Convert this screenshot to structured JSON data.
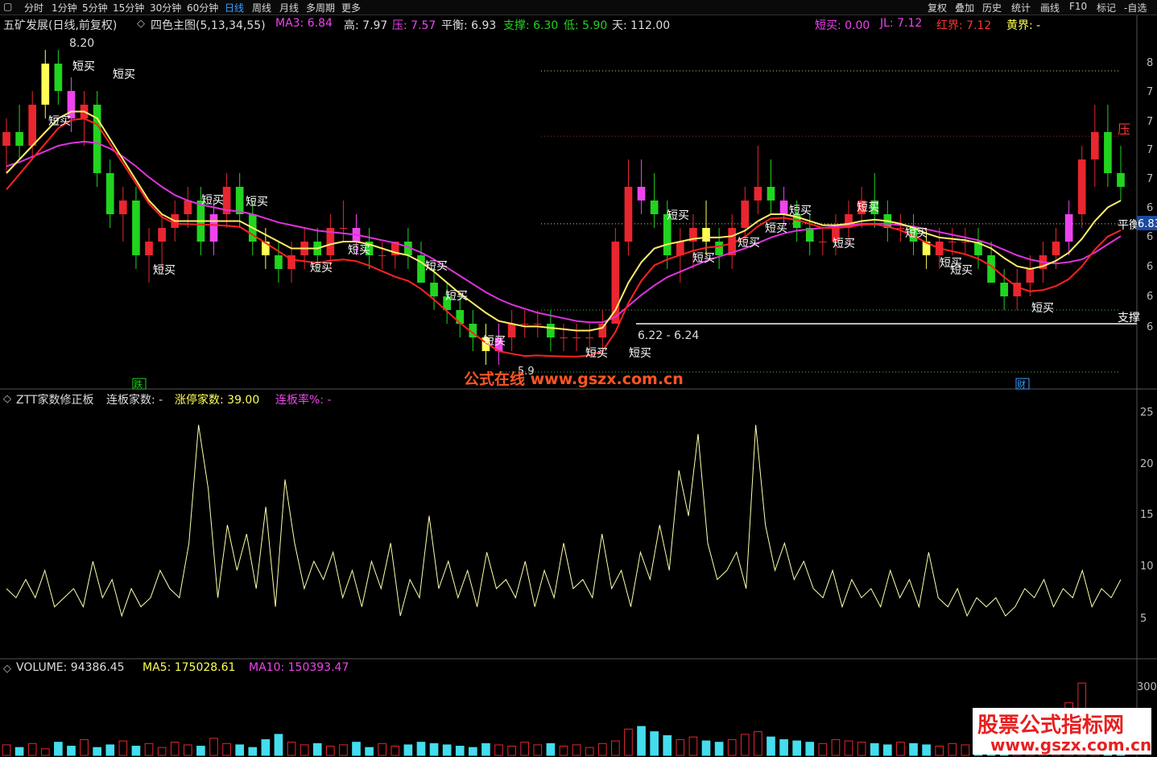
{
  "toolbar": {
    "left": [
      "分时",
      "1分钟",
      "5分钟",
      "15分钟",
      "30分钟",
      "60分钟",
      "日线",
      "周线",
      "月线",
      "多周期",
      "更多"
    ],
    "active": "日线",
    "right": [
      "复权",
      "叠加",
      "历史",
      "统计",
      "画线",
      "F10",
      "标记",
      "-自选"
    ]
  },
  "header1": {
    "stock": "五矿发展(日线,前复权)",
    "indicator": "四色主图(5,13,34,55)",
    "ma3": "MA3: 6.84",
    "high": "高: 7.97",
    "press": "压: 7.57",
    "balance": "平衡: 6.93",
    "support": "支撑: 6.30",
    "low": "低: 5.90",
    "days": "天: 112.00",
    "short_buy": "短买: 0.00",
    "jl": "JL: 7.12",
    "red_bound": "红界: 7.12",
    "yellow_bound": "黄界: -"
  },
  "header2": {
    "name": "ZTT家数修正板",
    "lianban": "连板家数: -",
    "zhangting": "涨停家数: 39.00",
    "rate": "连板率%: -"
  },
  "header3": {
    "vol": "VOLUME: 94386.45",
    "ma5": "MA5: 175028.61",
    "ma10": "MA10: 150393.47"
  },
  "annotations": {
    "peak": "8.20",
    "short_buy_label": "短买",
    "range": "6.22 - 6.24",
    "balance_line": "平衡",
    "balance_value": "6.83",
    "support_line": "支撑",
    "press_line": "压",
    "die": "跌",
    "cai": "财",
    "low_label": "5.9",
    "watermark1": "公式在线 www.gszx.com.cn",
    "watermark2": "股票公式指标网",
    "watermark3": "www.gszx.com.cn"
  },
  "colors": {
    "up": "#e8262f",
    "down": "#21d41f",
    "magenta": "#ee44ee",
    "yellow": "#ffff55",
    "ma_red": "#ff2222",
    "ma_magenta": "#dd33dd",
    "ma_yellow": "#ffee66",
    "vol_up": "#e8262f",
    "vol_down": "#44ddee"
  },
  "chart_data": [
    {
      "type": "candlestick",
      "title": "",
      "y_ticks": [
        "8",
        "7",
        "7",
        "7",
        "7",
        "6",
        "6",
        "6",
        "6",
        "6"
      ],
      "levels": {
        "press": 7.57,
        "balance": 6.93,
        "support": 6.3
      },
      "candles": [
        [
          7.5,
          7.7,
          7.3,
          7.6
        ],
        [
          7.6,
          7.8,
          7.4,
          7.5
        ],
        [
          7.5,
          7.9,
          7.4,
          7.8
        ],
        [
          7.8,
          8.2,
          7.7,
          8.1
        ],
        [
          8.1,
          8.2,
          7.8,
          7.9
        ],
        [
          7.9,
          8.0,
          7.6,
          7.7
        ],
        [
          7.7,
          7.9,
          7.5,
          7.8
        ],
        [
          7.8,
          7.9,
          7.2,
          7.3
        ],
        [
          7.3,
          7.4,
          6.9,
          7.0
        ],
        [
          7.0,
          7.2,
          6.8,
          7.1
        ],
        [
          7.1,
          7.2,
          6.6,
          6.7
        ],
        [
          6.7,
          6.9,
          6.5,
          6.8
        ],
        [
          6.8,
          7.0,
          6.6,
          6.9
        ],
        [
          6.9,
          7.1,
          6.8,
          7.0
        ],
        [
          7.0,
          7.2,
          6.9,
          7.1
        ],
        [
          7.1,
          7.2,
          6.7,
          6.8
        ],
        [
          6.8,
          7.1,
          6.7,
          7.0
        ],
        [
          7.0,
          7.3,
          6.9,
          7.2
        ],
        [
          7.2,
          7.3,
          6.9,
          7.0
        ],
        [
          7.0,
          7.1,
          6.7,
          6.8
        ],
        [
          6.8,
          6.9,
          6.6,
          6.7
        ],
        [
          6.7,
          6.8,
          6.5,
          6.6
        ],
        [
          6.6,
          6.8,
          6.5,
          6.7
        ],
        [
          6.7,
          6.9,
          6.6,
          6.8
        ],
        [
          6.8,
          6.9,
          6.6,
          6.7
        ],
        [
          6.7,
          7.0,
          6.6,
          6.9
        ],
        [
          6.9,
          7.1,
          6.8,
          6.9
        ],
        [
          6.9,
          7.0,
          6.7,
          6.8
        ],
        [
          6.8,
          6.9,
          6.6,
          6.7
        ],
        [
          6.7,
          6.8,
          6.6,
          6.7
        ],
        [
          6.7,
          6.8,
          6.6,
          6.8
        ],
        [
          6.8,
          6.9,
          6.6,
          6.7
        ],
        [
          6.7,
          6.8,
          6.5,
          6.5
        ],
        [
          6.5,
          6.6,
          6.3,
          6.4
        ],
        [
          6.4,
          6.5,
          6.2,
          6.3
        ],
        [
          6.3,
          6.4,
          6.1,
          6.2
        ],
        [
          6.2,
          6.3,
          6.0,
          6.1
        ],
        [
          6.1,
          6.2,
          5.9,
          6.0
        ],
        [
          6.0,
          6.2,
          5.9,
          6.1
        ],
        [
          6.1,
          6.3,
          6.0,
          6.2
        ],
        [
          6.2,
          6.3,
          6.1,
          6.2
        ],
        [
          6.2,
          6.3,
          6.1,
          6.2
        ],
        [
          6.2,
          6.3,
          6.0,
          6.1
        ],
        [
          6.1,
          6.2,
          6.0,
          6.1
        ],
        [
          6.1,
          6.2,
          6.0,
          6.1
        ],
        [
          6.1,
          6.2,
          6.0,
          6.1
        ],
        [
          6.1,
          6.3,
          6.0,
          6.2
        ],
        [
          6.2,
          6.9,
          6.2,
          6.8
        ],
        [
          6.8,
          7.4,
          6.7,
          7.2
        ],
        [
          7.2,
          7.4,
          7.0,
          7.1
        ],
        [
          7.1,
          7.3,
          6.9,
          7.0
        ],
        [
          7.0,
          7.1,
          6.6,
          6.7
        ],
        [
          6.7,
          6.9,
          6.5,
          6.8
        ],
        [
          6.8,
          7.0,
          6.6,
          6.9
        ],
        [
          6.9,
          7.1,
          6.7,
          6.8
        ],
        [
          6.8,
          6.9,
          6.6,
          6.7
        ],
        [
          6.7,
          7.0,
          6.6,
          6.9
        ],
        [
          6.9,
          7.2,
          6.8,
          7.1
        ],
        [
          7.1,
          7.5,
          7.0,
          7.2
        ],
        [
          7.2,
          7.4,
          7.0,
          7.1
        ],
        [
          7.1,
          7.2,
          6.9,
          7.0
        ],
        [
          7.0,
          7.1,
          6.8,
          6.9
        ],
        [
          6.9,
          7.0,
          6.7,
          6.8
        ],
        [
          6.8,
          6.9,
          6.7,
          6.8
        ],
        [
          6.8,
          7.0,
          6.7,
          6.9
        ],
        [
          6.9,
          7.1,
          6.8,
          7.0
        ],
        [
          7.0,
          7.2,
          6.9,
          7.1
        ],
        [
          7.1,
          7.3,
          6.9,
          7.0
        ],
        [
          7.0,
          7.1,
          6.8,
          6.9
        ],
        [
          6.9,
          7.0,
          6.8,
          6.9
        ],
        [
          6.9,
          7.0,
          6.7,
          6.8
        ],
        [
          6.8,
          6.9,
          6.6,
          6.7
        ],
        [
          6.7,
          6.9,
          6.6,
          6.8
        ],
        [
          6.8,
          6.9,
          6.7,
          6.8
        ],
        [
          6.8,
          6.9,
          6.7,
          6.8
        ],
        [
          6.8,
          6.9,
          6.6,
          6.7
        ],
        [
          6.7,
          6.8,
          6.5,
          6.5
        ],
        [
          6.5,
          6.6,
          6.3,
          6.4
        ],
        [
          6.4,
          6.6,
          6.3,
          6.5
        ],
        [
          6.5,
          6.7,
          6.4,
          6.6
        ],
        [
          6.6,
          6.8,
          6.5,
          6.7
        ],
        [
          6.7,
          6.9,
          6.6,
          6.8
        ],
        [
          6.8,
          7.1,
          6.7,
          7.0
        ],
        [
          7.0,
          7.5,
          6.9,
          7.4
        ],
        [
          7.4,
          7.8,
          7.2,
          7.6
        ],
        [
          7.6,
          7.8,
          7.2,
          7.3
        ],
        [
          7.3,
          7.5,
          7.1,
          7.2
        ]
      ],
      "ma_fast": [
        7.3,
        7.4,
        7.5,
        7.6,
        7.7,
        7.75,
        7.75,
        7.7,
        7.55,
        7.4,
        7.25,
        7.1,
        7.0,
        6.95,
        6.95,
        6.95,
        6.95,
        6.95,
        6.95,
        6.9,
        6.85,
        6.8,
        6.75,
        6.75,
        6.75,
        6.78,
        6.8,
        6.8,
        6.78,
        6.75,
        6.72,
        6.7,
        6.65,
        6.58,
        6.5,
        6.42,
        6.35,
        6.28,
        6.22,
        6.2,
        6.18,
        6.18,
        6.17,
        6.16,
        6.15,
        6.15,
        6.17,
        6.3,
        6.5,
        6.65,
        6.75,
        6.78,
        6.8,
        6.82,
        6.83,
        6.83,
        6.84,
        6.88,
        6.95,
        7.0,
        7.0,
        6.98,
        6.95,
        6.92,
        6.92,
        6.93,
        6.95,
        6.96,
        6.95,
        6.93,
        6.9,
        6.86,
        6.83,
        6.82,
        6.81,
        6.79,
        6.75,
        6.68,
        6.62,
        6.6,
        6.62,
        6.66,
        6.72,
        6.82,
        6.95,
        7.05,
        7.1
      ],
      "ma_slow": [
        7.35,
        7.38,
        7.42,
        7.46,
        7.5,
        7.52,
        7.53,
        7.52,
        7.48,
        7.42,
        7.35,
        7.27,
        7.2,
        7.14,
        7.1,
        7.07,
        7.05,
        7.03,
        7.02,
        7.0,
        6.97,
        6.94,
        6.92,
        6.9,
        6.88,
        6.87,
        6.86,
        6.85,
        6.83,
        6.81,
        6.79,
        6.76,
        6.72,
        6.67,
        6.61,
        6.55,
        6.49,
        6.43,
        6.38,
        6.34,
        6.31,
        6.28,
        6.26,
        6.24,
        6.22,
        6.21,
        6.21,
        6.25,
        6.33,
        6.41,
        6.48,
        6.54,
        6.58,
        6.62,
        6.66,
        6.69,
        6.72,
        6.75,
        6.79,
        6.83,
        6.86,
        6.88,
        6.89,
        6.9,
        6.91,
        6.92,
        6.93,
        6.93,
        6.93,
        6.92,
        6.91,
        6.89,
        6.87,
        6.85,
        6.83,
        6.81,
        6.78,
        6.74,
        6.7,
        6.67,
        6.65,
        6.64,
        6.65,
        6.67,
        6.72,
        6.78,
        6.84
      ]
    },
    {
      "type": "line",
      "title": "",
      "y_ticks": [
        "25",
        "20",
        "15",
        "10",
        "5"
      ],
      "ylim": [
        0,
        27
      ],
      "values": [
        7,
        6,
        8,
        6,
        9,
        5,
        6,
        7,
        5,
        10,
        6,
        8,
        4,
        7,
        5,
        6,
        9,
        7,
        6,
        12,
        25,
        18,
        6,
        14,
        9,
        13,
        7,
        16,
        5,
        19,
        12,
        7,
        10,
        8,
        11,
        6,
        9,
        5,
        10,
        7,
        12,
        4,
        8,
        6,
        15,
        7,
        10,
        6,
        9,
        5,
        11,
        7,
        8,
        6,
        10,
        5,
        9,
        6,
        12,
        7,
        8,
        6,
        13,
        7,
        9,
        5,
        11,
        8,
        14,
        9,
        20,
        15,
        24,
        12,
        8,
        9,
        11,
        7,
        25,
        14,
        9,
        12,
        8,
        10,
        7,
        6,
        9,
        5,
        8,
        6,
        7,
        5,
        9,
        6,
        8,
        5,
        11,
        6,
        5,
        7,
        4,
        6,
        5,
        6,
        4,
        5,
        7,
        6,
        8,
        5,
        7,
        6,
        9,
        5,
        7,
        6,
        8
      ]
    },
    {
      "type": "bar",
      "title": "",
      "y_ticks": [
        "300"
      ],
      "values": [
        8,
        6,
        9,
        5,
        10,
        7,
        12,
        6,
        8,
        11,
        7,
        9,
        6,
        10,
        8,
        7,
        13,
        9,
        8,
        6,
        12,
        16,
        10,
        8,
        9,
        7,
        8,
        10,
        6,
        9,
        7,
        8,
        10,
        9,
        8,
        7,
        6,
        9,
        8,
        7,
        10,
        8,
        9,
        7,
        8,
        6,
        9,
        11,
        20,
        22,
        18,
        15,
        12,
        14,
        11,
        10,
        12,
        16,
        18,
        14,
        12,
        11,
        10,
        9,
        12,
        11,
        10,
        9,
        8,
        10,
        9,
        8,
        7,
        9,
        8,
        10,
        9,
        12,
        14,
        18,
        22,
        30,
        40,
        55,
        25,
        20,
        18
      ]
    }
  ]
}
